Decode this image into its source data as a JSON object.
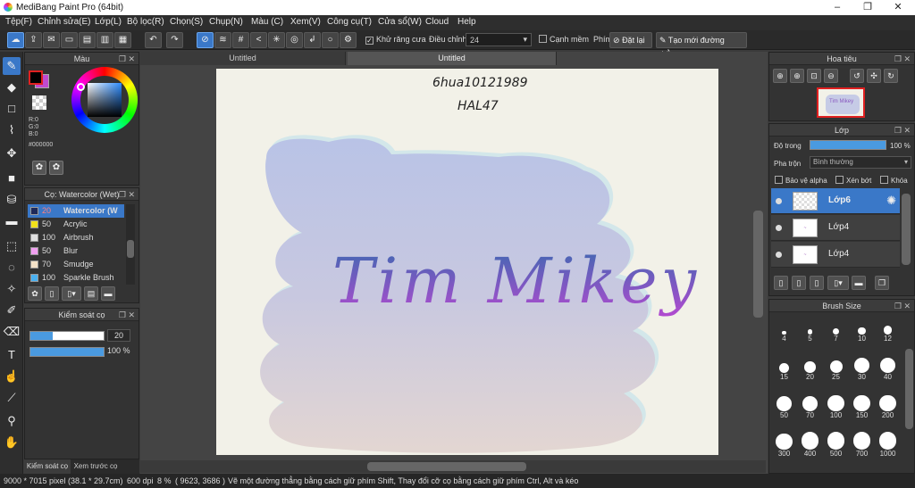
{
  "window": {
    "title": "MediBang Paint Pro (64bit)",
    "minimize": "–",
    "maximize": "❐",
    "close": "✕"
  },
  "menu": [
    "Tệp(F)",
    "Chỉnh sửa(E)",
    "Lớp(L)",
    "Bộ lọc(R)",
    "Chọn(S)",
    "Chụp(N)",
    "Màu (C)",
    "Xem(V)",
    "Công cụ(T)",
    "Cửa sổ(W)",
    "Cloud",
    "Help"
  ],
  "toolbar": {
    "antialias_label": "Khử răng cưa",
    "correction_label": "Điều chỉnh",
    "correction_value": "24",
    "smooth_label": "Cạnh mềm",
    "key_label": "Phím",
    "reset_label": "Đặt lại",
    "straight_line_label": "Tạo mới đường thẳng"
  },
  "docs": {
    "tabs": [
      "Untitled",
      "Untitled"
    ],
    "active_tab": 1
  },
  "canvas": {
    "handwriting_line1": "6hua10121989",
    "handwriting_line2": "HAL47",
    "artwork_text": "Tim Mikey"
  },
  "color_panel": {
    "title": "Màu",
    "r": "R:0",
    "g": "G:0",
    "b": "B:0",
    "hex": "#000000",
    "primary": "#000000",
    "secondary": "#c04ad0"
  },
  "brush_panel": {
    "title": "Cọ: Watercolor (Wet)",
    "items": [
      {
        "size": "20",
        "name": "Watercolor (W",
        "color": "#1e2a5a"
      },
      {
        "size": "50",
        "name": "Acrylic",
        "color": "#f2e21a"
      },
      {
        "size": "100",
        "name": "Airbrush",
        "color": "#e0e0e0"
      },
      {
        "size": "50",
        "name": "Blur",
        "color": "#f0a0f0"
      },
      {
        "size": "70",
        "name": "Smudge",
        "color": "#f4e2c8"
      },
      {
        "size": "100",
        "name": "Sparkle Brush",
        "color": "#4ab0f0"
      }
    ]
  },
  "brush_control": {
    "title": "Kiểm soát cọ",
    "size_value": "20",
    "size_fill": 0.3,
    "opacity_value": "100 %",
    "opacity_fill": 1.0
  },
  "bottom_tabs": [
    "Kiểm soát cọ",
    "Xem trước cọ"
  ],
  "navigator": {
    "title": "Hoa tiêu",
    "preview_text": "Tim Mikey"
  },
  "layer_panel": {
    "title": "Lớp",
    "opacity_label": "Độ trong",
    "opacity_value": "100 %",
    "blend_label": "Pha trộn",
    "blend_value": "Bình thường",
    "protect_alpha": "Bảo vệ alpha",
    "clipping": "Xén bớt",
    "lock": "Khóa",
    "layers": [
      {
        "name": "Lớp6",
        "selected": true
      },
      {
        "name": "Lớp4",
        "selected": false
      },
      {
        "name": "Lớp4",
        "selected": false
      }
    ]
  },
  "brush_size": {
    "title": "Brush Size",
    "sizes": [
      "4",
      "5",
      "7",
      "10",
      "12",
      "15",
      "20",
      "25",
      "30",
      "40",
      "50",
      "70",
      "100",
      "150",
      "200",
      "300",
      "400",
      "500",
      "700",
      "1000"
    ]
  },
  "status": {
    "dimensions": "9000 * 7015 pixel",
    "physical": "(38.1 * 29.7cm)",
    "dpi": "600 dpi",
    "zoom": "8 %",
    "cursor": "( 9623, 3686 )",
    "hint": "Vẽ một đường thẳng bằng cách giữ phím Shift, Thay đổi cỡ cọ bằng cách giữ phím Ctrl, Alt và kéo"
  }
}
